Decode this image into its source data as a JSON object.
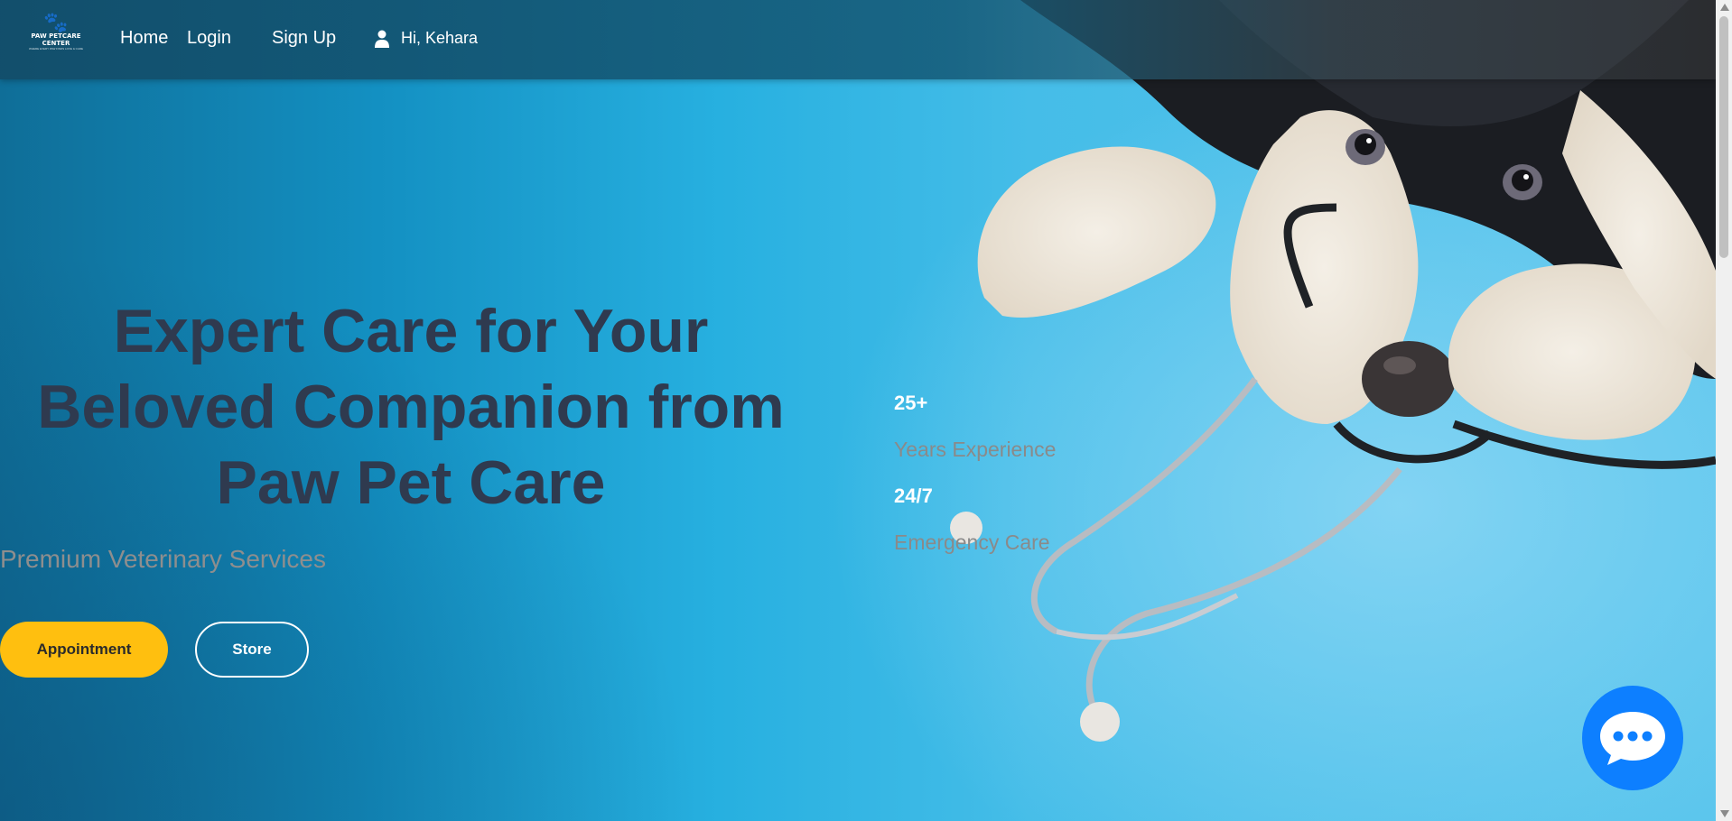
{
  "nav": {
    "logo_text": "PAW PETCARE CENTER",
    "logo_subtext": "WHERE EVERY PAW FINDS LOVE & CARE",
    "home_label": "Home",
    "login_label": "Login",
    "signup_label": "Sign Up",
    "user_greeting": "Hi, Kehara"
  },
  "hero": {
    "headline": "Expert Care for Your Beloved Companion from Paw Pet Care",
    "subtitle": "Premium Veterinary Services",
    "appointment_label": "Appointment",
    "store_label": "Store"
  },
  "stats": [
    {
      "value": "25+",
      "label": "Years Experience"
    },
    {
      "value": "24/7",
      "label": "Emergency Care"
    }
  ],
  "icons": {
    "logo": "paw-icon",
    "user": "user-icon",
    "chat": "chat-bubble-icon"
  },
  "colors": {
    "headline": "#2f3a4f",
    "appointment_button": "#ffbf0f",
    "chat_button": "#0d7fff",
    "muted_text": "#8e8e8e"
  }
}
